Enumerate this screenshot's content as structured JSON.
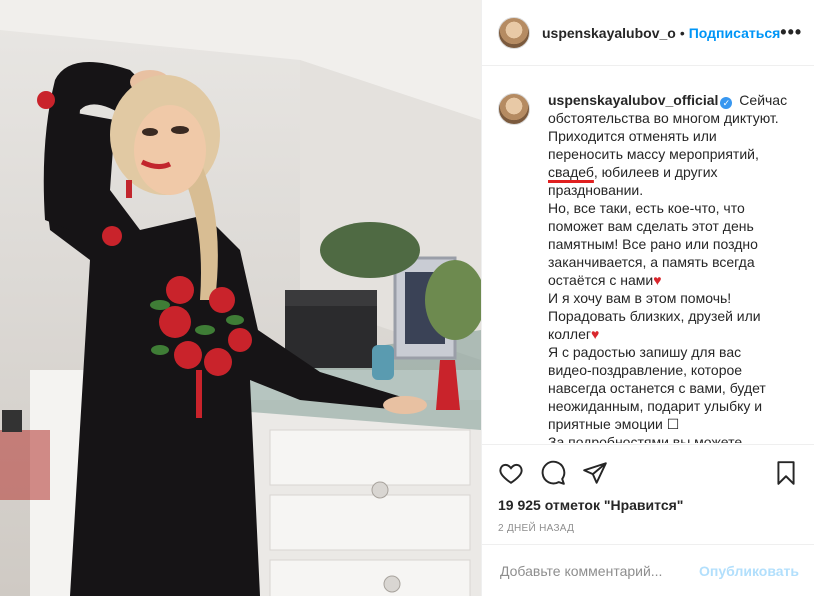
{
  "post": {
    "username": "uspenskayalubov_official",
    "username_short": "uspenskayalubov_o",
    "follow_label": "Подписаться",
    "more_label": "•••",
    "verified_icon": "verified-badge-icon"
  },
  "caption": {
    "lines": [
      "Сейчас обстоятельства во многом диктуют.",
      "Приходится отменять или переносить массу мероприятий,",
      "свадеб",
      ", юбилеев и других праздновании.",
      "Но, все таки, есть кое-что, что поможет вам сделать этот день памятным! Все рано или поздно заканчивается, а память всегда остаётся с нами",
      "И я хочу вам в этом помочь!",
      "Порадовать близких, друзей или коллег",
      "Я с радостью запишу для вас видео-поздравление, которое навсегда останется с вами, будет неожиданным, подарит улыбку и приятные эмоции ☐",
      "За подробностями вы можете"
    ],
    "heart": "♥"
  },
  "actions": {
    "likes": "19 925 отметок \"Нравится\"",
    "date": "2 ДНЕЙ НАЗАД"
  },
  "comment": {
    "placeholder": "Добавьте комментарий...",
    "publish_label": "Опубликовать"
  },
  "colors": {
    "link": "#0095f6",
    "publish_disabled": "#b2dffc",
    "underline": "#e02020",
    "heart": "#d9262c"
  }
}
